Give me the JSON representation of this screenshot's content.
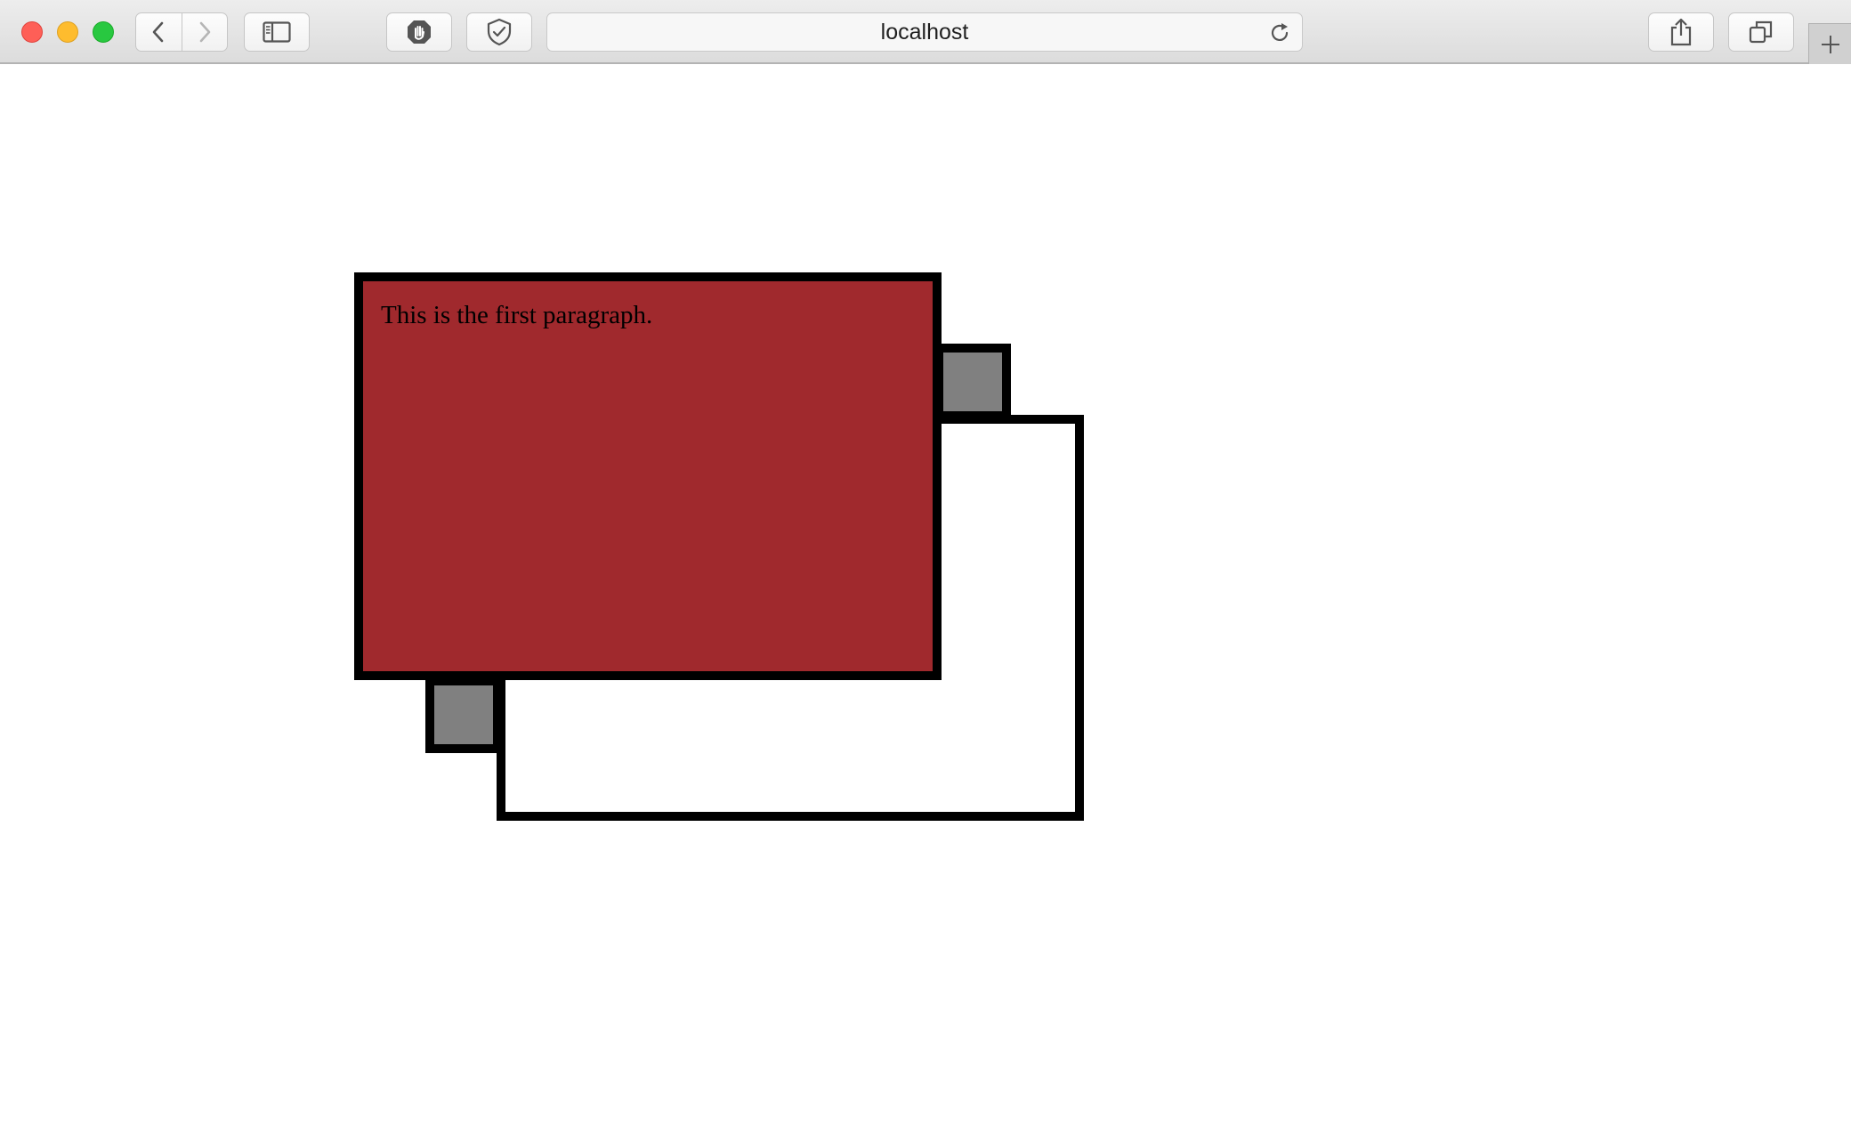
{
  "browser": {
    "address_bar": {
      "url": "localhost"
    },
    "buttons": {
      "back_icon": "chevron-left-icon",
      "forward_icon": "chevron-right-icon",
      "sidebar_icon": "sidebar-icon",
      "privacy_icon": "hand-icon",
      "shield_icon": "shield-icon",
      "reload_icon": "reload-icon",
      "share_icon": "share-icon",
      "tabs_icon": "tabs-icon",
      "new_tab_icon": "plus-icon"
    }
  },
  "content": {
    "first_paragraph": "This is the first paragraph.",
    "colors": {
      "front_box": "#a0292d",
      "small_squares": "#808080",
      "back_box": "#ffffff",
      "borders": "#000000"
    }
  }
}
